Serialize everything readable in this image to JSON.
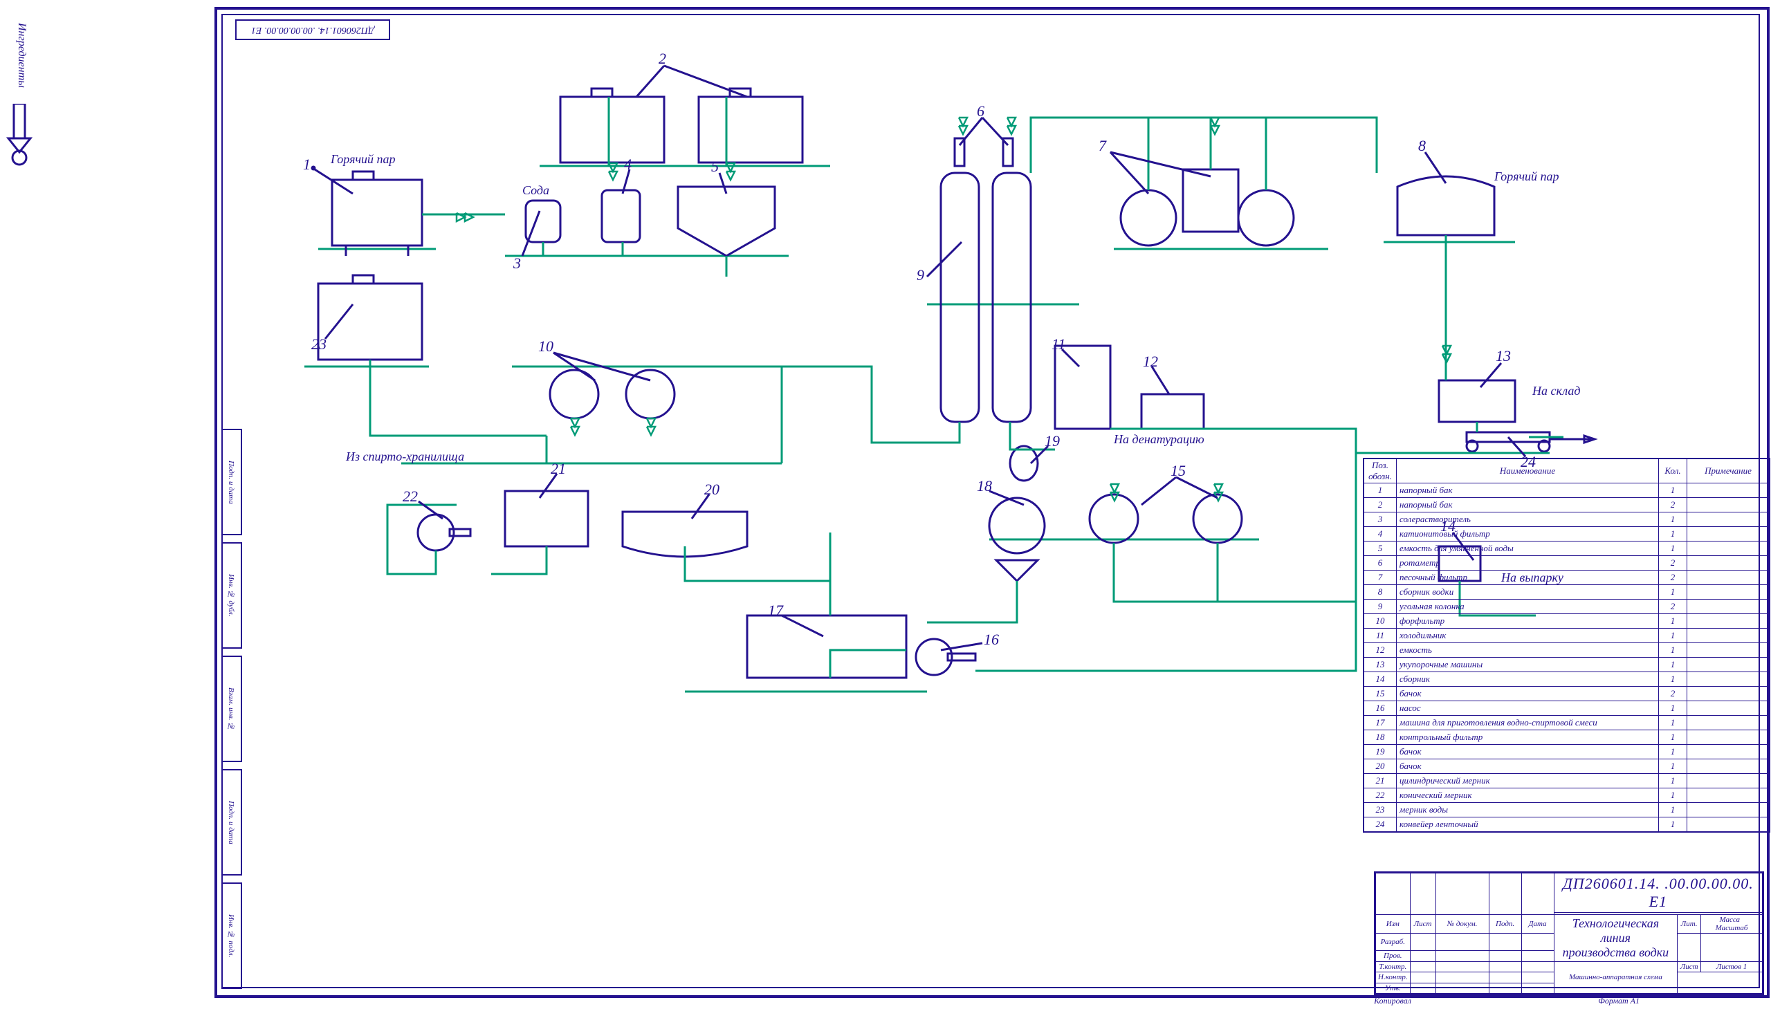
{
  "domain": "Diagram",
  "stamp_rev": "ДП260601.14. .00.00.00.00. Е1",
  "side_labels": [
    "Подп. и дата",
    "Инв. № дубл.",
    "Взам. инв. №",
    "Подп. и дата",
    "Инв. № подл."
  ],
  "ingredient_label": "Ингредиенты",
  "annotations": {
    "hot_steam_left": "Горячий пар",
    "hot_steam_right": "Горячий пар",
    "soda": "Сода",
    "from_storage": "Из спирто-хранилища",
    "to_denat": "На денатурацию",
    "to_warehouse": "На склад",
    "to_evap": "На выпарку"
  },
  "callouts": [
    "1",
    "2",
    "3",
    "4",
    "5",
    "6",
    "7",
    "8",
    "9",
    "10",
    "11",
    "12",
    "13",
    "14",
    "15",
    "16",
    "17",
    "18",
    "19",
    "20",
    "21",
    "22",
    "23",
    "24"
  ],
  "parts_header": {
    "pos": "Поз.\nобозн.",
    "name": "Наименование",
    "qty": "Кол.",
    "note": "Примечание"
  },
  "parts": [
    {
      "pos": "1",
      "name": "напорный бак",
      "qty": "1"
    },
    {
      "pos": "2",
      "name": "напорный бак",
      "qty": "2"
    },
    {
      "pos": "3",
      "name": "солерастворитель",
      "qty": "1"
    },
    {
      "pos": "4",
      "name": "катионитовый фильтр",
      "qty": "1"
    },
    {
      "pos": "5",
      "name": "емкость для умягченной воды",
      "qty": "1"
    },
    {
      "pos": "6",
      "name": "ротаметр",
      "qty": "2"
    },
    {
      "pos": "7",
      "name": "песочный фильтр",
      "qty": "2"
    },
    {
      "pos": "8",
      "name": "сборник водки",
      "qty": "1"
    },
    {
      "pos": "9",
      "name": "угольная колонка",
      "qty": "2"
    },
    {
      "pos": "10",
      "name": "форфильтр",
      "qty": "1"
    },
    {
      "pos": "11",
      "name": "холодильник",
      "qty": "1"
    },
    {
      "pos": "12",
      "name": "емкость",
      "qty": "1"
    },
    {
      "pos": "13",
      "name": "укупорочные машины",
      "qty": "1"
    },
    {
      "pos": "14",
      "name": "сборник",
      "qty": "1"
    },
    {
      "pos": "15",
      "name": "бачок",
      "qty": "2"
    },
    {
      "pos": "16",
      "name": "насос",
      "qty": "1"
    },
    {
      "pos": "17",
      "name": "машина для приготовления водно-спиртовой смеси",
      "qty": "1"
    },
    {
      "pos": "18",
      "name": "контрольный фильтр",
      "qty": "1"
    },
    {
      "pos": "19",
      "name": "бачок",
      "qty": "1"
    },
    {
      "pos": "20",
      "name": "бачок",
      "qty": "1"
    },
    {
      "pos": "21",
      "name": "цилиндрический мерник",
      "qty": "1"
    },
    {
      "pos": "22",
      "name": "конический мерник",
      "qty": "1"
    },
    {
      "pos": "23",
      "name": "мерник воды",
      "qty": "1"
    },
    {
      "pos": "24",
      "name": "конвейер ленточный",
      "qty": "1"
    }
  ],
  "title_block": {
    "code": "ДП260601.14. .00.00.00.00. Е1",
    "title1": "Технологическая линия",
    "title2": "производства водки",
    "subtype": "Машинно-аппаратная схема",
    "rows": [
      "Изм",
      "Лист",
      "№ докум.",
      "Подп.",
      "Дата"
    ],
    "left_rows": [
      "Разраб.",
      "Пров.",
      "Т.контр.",
      "",
      "Н.контр.",
      "Утв."
    ],
    "lit": "Лит.",
    "mass": "Масса",
    "scale": "Масштаб",
    "sheet": "Лист",
    "sheets": "Листов",
    "sheets_val": "1",
    "format": "Формат  А1",
    "copied": "Копировал"
  }
}
